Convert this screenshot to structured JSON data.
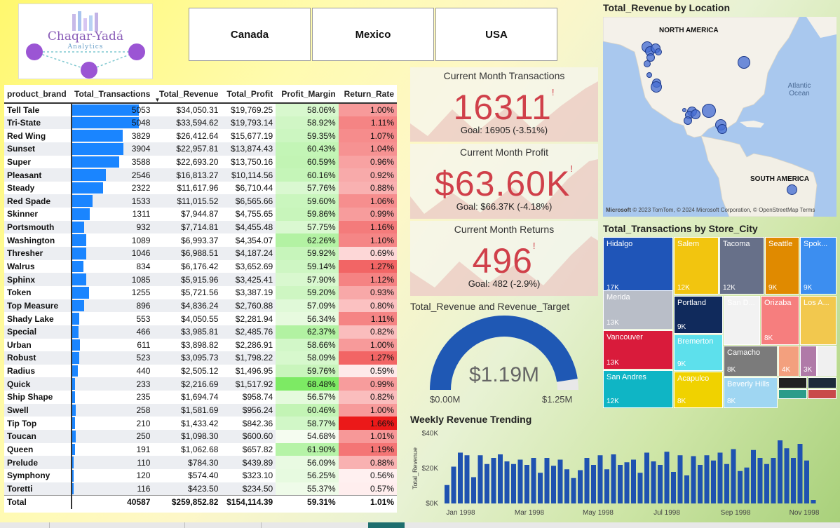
{
  "logo": {
    "name": "Chaqar-Yadá",
    "tagline": "Analytics"
  },
  "slicer": {
    "items": [
      "Canada",
      "Mexico",
      "USA"
    ]
  },
  "table": {
    "headers": [
      "product_brand",
      "Total_Transactions",
      "Total_Revenue",
      "Total_Profit",
      "Profit_Margin",
      "Return_Rate"
    ],
    "rows": [
      {
        "brand": "Tell Tale",
        "tt": "5053",
        "rev": "$34,050.31",
        "profit": "$19,769.25",
        "pm": "58.06%",
        "rr": "1.00%"
      },
      {
        "brand": "Tri-State",
        "tt": "5048",
        "rev": "$33,594.62",
        "profit": "$19,793.14",
        "pm": "58.92%",
        "rr": "1.11%"
      },
      {
        "brand": "Red Wing",
        "tt": "3829",
        "rev": "$26,412.64",
        "profit": "$15,677.19",
        "pm": "59.35%",
        "rr": "1.07%"
      },
      {
        "brand": "Sunset",
        "tt": "3904",
        "rev": "$22,957.81",
        "profit": "$13,874.43",
        "pm": "60.43%",
        "rr": "1.04%"
      },
      {
        "brand": "Super",
        "tt": "3588",
        "rev": "$22,693.20",
        "profit": "$13,750.16",
        "pm": "60.59%",
        "rr": "0.96%"
      },
      {
        "brand": "Pleasant",
        "tt": "2546",
        "rev": "$16,813.27",
        "profit": "$10,114.56",
        "pm": "60.16%",
        "rr": "0.92%"
      },
      {
        "brand": "Steady",
        "tt": "2322",
        "rev": "$11,617.96",
        "profit": "$6,710.44",
        "pm": "57.76%",
        "rr": "0.88%"
      },
      {
        "brand": "Red Spade",
        "tt": "1533",
        "rev": "$11,015.52",
        "profit": "$6,565.66",
        "pm": "59.60%",
        "rr": "1.06%"
      },
      {
        "brand": "Skinner",
        "tt": "1311",
        "rev": "$7,944.87",
        "profit": "$4,755.65",
        "pm": "59.86%",
        "rr": "0.99%"
      },
      {
        "brand": "Portsmouth",
        "tt": "932",
        "rev": "$7,714.81",
        "profit": "$4,455.48",
        "pm": "57.75%",
        "rr": "1.16%"
      },
      {
        "brand": "Washington",
        "tt": "1089",
        "rev": "$6,993.37",
        "profit": "$4,354.07",
        "pm": "62.26%",
        "rr": "1.10%"
      },
      {
        "brand": "Thresher",
        "tt": "1046",
        "rev": "$6,988.51",
        "profit": "$4,187.24",
        "pm": "59.92%",
        "rr": "0.69%"
      },
      {
        "brand": "Walrus",
        "tt": "834",
        "rev": "$6,176.42",
        "profit": "$3,652.69",
        "pm": "59.14%",
        "rr": "1.27%"
      },
      {
        "brand": "Sphinx",
        "tt": "1085",
        "rev": "$5,915.96",
        "profit": "$3,425.41",
        "pm": "57.90%",
        "rr": "1.12%"
      },
      {
        "brand": "Token",
        "tt": "1255",
        "rev": "$5,721.56",
        "profit": "$3,387.19",
        "pm": "59.20%",
        "rr": "0.93%"
      },
      {
        "brand": "Top Measure",
        "tt": "896",
        "rev": "$4,836.24",
        "profit": "$2,760.88",
        "pm": "57.09%",
        "rr": "0.80%"
      },
      {
        "brand": "Shady Lake",
        "tt": "553",
        "rev": "$4,050.55",
        "profit": "$2,281.94",
        "pm": "56.34%",
        "rr": "1.11%"
      },
      {
        "brand": "Special",
        "tt": "466",
        "rev": "$3,985.81",
        "profit": "$2,485.76",
        "pm": "62.37%",
        "rr": "0.82%"
      },
      {
        "brand": "Urban",
        "tt": "611",
        "rev": "$3,898.82",
        "profit": "$2,286.91",
        "pm": "58.66%",
        "rr": "1.00%"
      },
      {
        "brand": "Robust",
        "tt": "523",
        "rev": "$3,095.73",
        "profit": "$1,798.22",
        "pm": "58.09%",
        "rr": "1.27%"
      },
      {
        "brand": "Radius",
        "tt": "440",
        "rev": "$2,505.12",
        "profit": "$1,496.95",
        "pm": "59.76%",
        "rr": "0.59%"
      },
      {
        "brand": "Quick",
        "tt": "233",
        "rev": "$2,216.69",
        "profit": "$1,517.92",
        "pm": "68.48%",
        "rr": "0.99%"
      },
      {
        "brand": "Ship Shape",
        "tt": "235",
        "rev": "$1,694.74",
        "profit": "$958.74",
        "pm": "56.57%",
        "rr": "0.82%"
      },
      {
        "brand": "Swell",
        "tt": "258",
        "rev": "$1,581.69",
        "profit": "$956.24",
        "pm": "60.46%",
        "rr": "1.00%"
      },
      {
        "brand": "Tip Top",
        "tt": "210",
        "rev": "$1,433.42",
        "profit": "$842.36",
        "pm": "58.77%",
        "rr": "1.66%"
      },
      {
        "brand": "Toucan",
        "tt": "250",
        "rev": "$1,098.30",
        "profit": "$600.60",
        "pm": "54.68%",
        "rr": "1.01%"
      },
      {
        "brand": "Queen",
        "tt": "191",
        "rev": "$1,062.68",
        "profit": "$657.82",
        "pm": "61.90%",
        "rr": "1.19%"
      },
      {
        "brand": "Prelude",
        "tt": "110",
        "rev": "$784.30",
        "profit": "$439.89",
        "pm": "56.09%",
        "rr": "0.88%"
      },
      {
        "brand": "Symphony",
        "tt": "120",
        "rev": "$574.40",
        "profit": "$323.10",
        "pm": "56.25%",
        "rr": "0.56%"
      },
      {
        "brand": "Toretti",
        "tt": "116",
        "rev": "$423.50",
        "profit": "$234.50",
        "pm": "55.37%",
        "rr": "0.57%"
      }
    ],
    "total": {
      "brand": "Total",
      "tt": "40587",
      "rev": "$259,852.82",
      "profit": "$154,114.39",
      "pm": "59.31%",
      "rr": "1.01%"
    }
  },
  "kpis": [
    {
      "title": "Current Month Transactions",
      "value": "16311",
      "goal": "Goal: 16905 (-3.51%)",
      "flag": "!"
    },
    {
      "title": "Current Month Profit",
      "value": "$63.60K",
      "goal": "Goal: $66.37K (-4.18%)",
      "flag": "!"
    },
    {
      "title": "Current Month Returns",
      "value": "496",
      "goal": "Goal: 482 (-2.9%)",
      "flag": "!"
    }
  ],
  "gauge": {
    "title": "Total_Revenue and Revenue_Target",
    "value_label": "$1.19M",
    "min_label": "$0.00M",
    "max_label": "$1.25M",
    "fraction": 0.952
  },
  "map": {
    "title": "Total_Revenue by Location",
    "labels": {
      "north_america": "NORTH AMERICA",
      "ocean": "Atlantic Ocean",
      "south_america": "SOUTH AMERICA"
    },
    "attribution": "© 2023 TomTom, © 2024 Microsoft Corporation, © OpenStreetMap  Terms",
    "brand": "Microsoft"
  },
  "treemap": {
    "title": "Total_Transactions by Store_City",
    "tiles": [
      {
        "name": "Hidalgo",
        "value": "17K",
        "color": "#1f55b8"
      },
      {
        "name": "Salem",
        "value": "12K",
        "color": "#f2c50f"
      },
      {
        "name": "Tacoma",
        "value": "12K",
        "color": "#677089"
      },
      {
        "name": "Seattle",
        "value": "9K",
        "color": "#e08a00"
      },
      {
        "name": "Spok...",
        "value": "9K",
        "color": "#3c8ef0"
      },
      {
        "name": "Merida",
        "value": "13K",
        "color": "#b9bec8"
      },
      {
        "name": "Portland",
        "value": "9K",
        "color": "#102a5c"
      },
      {
        "name": "San D...",
        "value": "",
        "color": "#f2f2f2"
      },
      {
        "name": "Orizaba",
        "value": "8K",
        "color": "#f67e7e"
      },
      {
        "name": "Los A...",
        "value": "",
        "color": "#f2c84e"
      },
      {
        "name": "Vancouver",
        "value": "13K",
        "color": "#d91b3b"
      },
      {
        "name": "Bremerton",
        "value": "9K",
        "color": "#5de0ec"
      },
      {
        "name": "Camacho",
        "value": "8K",
        "color": "#7b7b7b"
      },
      {
        "name": "",
        "value": "4K",
        "color": "#f3a07e"
      },
      {
        "name": "",
        "value": "3K",
        "color": "#b07aa8"
      },
      {
        "name": "San Andres",
        "value": "12K",
        "color": "#0fb5c5"
      },
      {
        "name": "Acapulco",
        "value": "8K",
        "color": "#f0d200"
      },
      {
        "name": "Beverly Hills",
        "value": "8K",
        "color": "#9fd6f2"
      }
    ]
  },
  "weekly": {
    "title": "Weekly Revenue Trending"
  },
  "chart_data": {
    "type": "bar",
    "title": "Weekly Revenue Trending",
    "xlabel": "",
    "ylabel": "Total_Revenue",
    "ylim": [
      0,
      40000
    ],
    "yticks": [
      "$0K",
      "$20K",
      "$40K"
    ],
    "xticks": [
      "Jan 1998",
      "Mar 1998",
      "May 1998",
      "Jul 1998",
      "Sep 1998",
      "Nov 1998"
    ],
    "values": [
      10500,
      21000,
      29000,
      27500,
      15000,
      27500,
      22500,
      26000,
      28000,
      24000,
      22500,
      25000,
      22000,
      26000,
      17500,
      26000,
      21500,
      25000,
      19500,
      14500,
      19000,
      26000,
      22000,
      27500,
      19500,
      28000,
      22000,
      23500,
      25000,
      17500,
      29000,
      24000,
      22000,
      29500,
      18000,
      27500,
      16000,
      27000,
      22000,
      27500,
      24500,
      29000,
      22500,
      31000,
      18500,
      20500,
      30500,
      26000,
      22500,
      26000,
      36000,
      31500,
      26000,
      34000,
      24500,
      2000
    ]
  }
}
